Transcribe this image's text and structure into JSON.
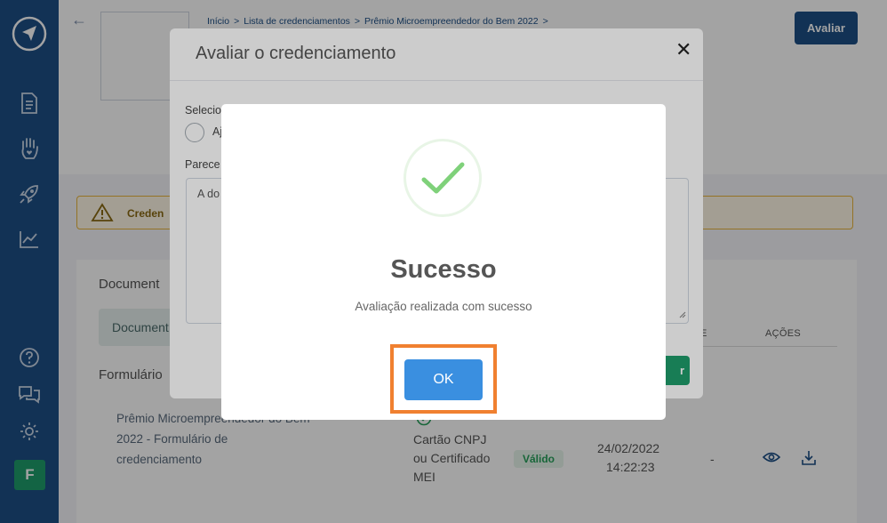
{
  "breadcrumb": {
    "items": [
      "Início",
      "Lista de credenciamentos",
      "Prêmio Microempreendedor do Bem 2022"
    ],
    "separator": ">"
  },
  "header": {
    "avaliar_label": "Avaliar"
  },
  "alert": {
    "text": "Creden"
  },
  "sections": {
    "documents_title": "Document",
    "documents_tab": "Document",
    "forms_title": "Formulário",
    "form_link": "Prêmio Microempreendedor do Bem 2022 - Formulário de credenciamento"
  },
  "table": {
    "headers": [
      "E",
      "AÇÕES"
    ],
    "row": {
      "name": "Cartão CNPJ ou Certificado MEI",
      "status": "Válido",
      "date": "24/02/2022",
      "time": "14:22:23",
      "extra": "-"
    }
  },
  "modal_evaluate": {
    "title": "Avaliar o credenciamento",
    "select_label": "Selecio",
    "radio_label": "Aj",
    "parecer_label": "Parece",
    "textarea_value": "A do",
    "confirm_label": "r"
  },
  "modal_success": {
    "title": "Sucesso",
    "message": "Avaliação realizada com sucesso",
    "ok_label": "OK"
  },
  "colors": {
    "sidebar": "#1d4f86",
    "success_green": "#5cc85c",
    "ok_button": "#3a8fe0",
    "highlight": "#f08030"
  },
  "user": {
    "avatar_initial": "F"
  }
}
